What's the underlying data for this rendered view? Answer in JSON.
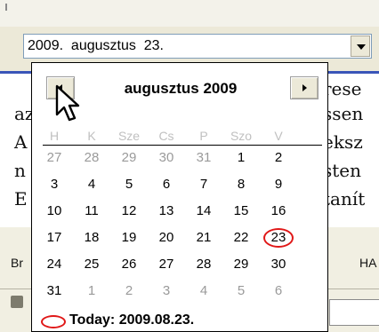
{
  "date_combo": {
    "value": "2009.  augusztus  23.",
    "dropdown_icon": "chevron-down-icon"
  },
  "calendar": {
    "title": "augusztus 2009",
    "prev_icon": "arrow-left-icon",
    "next_icon": "arrow-right-icon",
    "weekdays": [
      "H",
      "K",
      "Sze",
      "Cs",
      "P",
      "Szo",
      "V"
    ],
    "weeks": [
      [
        "27",
        "28",
        "29",
        "30",
        "31",
        "1",
        "2"
      ],
      [
        "3",
        "4",
        "5",
        "6",
        "7",
        "8",
        "9"
      ],
      [
        "10",
        "11",
        "12",
        "13",
        "14",
        "15",
        "16"
      ],
      [
        "17",
        "18",
        "19",
        "20",
        "21",
        "22",
        "23"
      ],
      [
        "24",
        "25",
        "26",
        "27",
        "28",
        "29",
        "30"
      ],
      [
        "31",
        "1",
        "2",
        "3",
        "4",
        "5",
        "6"
      ]
    ],
    "today_label": "Today: 2009.08.23.",
    "highlight_color": "#e01818"
  },
  "background_document": {
    "lines": [
      {
        "left": "",
        "right": "rese"
      },
      {
        "left": "az",
        "right": "ssen"
      },
      {
        "left": "A",
        "right": "eksz"
      },
      {
        "left": "n",
        "right": "sten"
      },
      {
        "left": "E",
        "right": "tanít"
      }
    ],
    "toolbar_left": "Br",
    "toolbar_right": "HA"
  }
}
